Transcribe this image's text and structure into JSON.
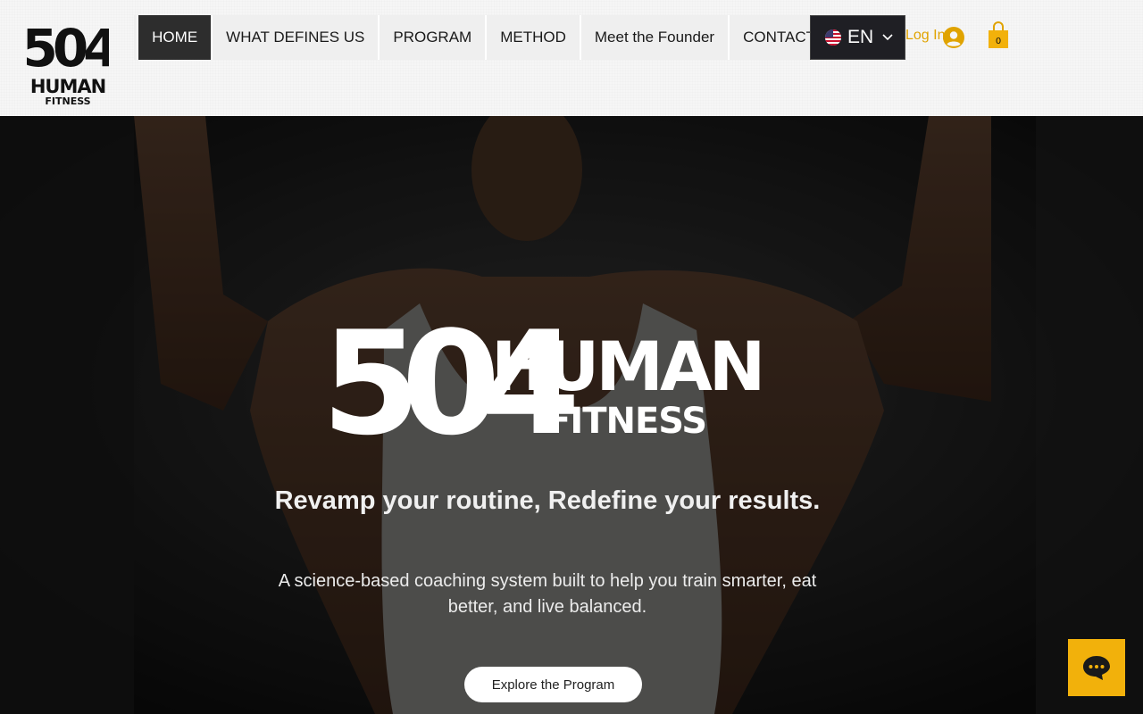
{
  "brand": {
    "name": "504 HUMAN FITNESS",
    "logo_numbers": "504",
    "logo_word": "HUMAN",
    "logo_sub": "FITNESS"
  },
  "nav": {
    "items": [
      {
        "label": "HOME",
        "active": true
      },
      {
        "label": "WHAT DEFINES US"
      },
      {
        "label": "PROGRAM"
      },
      {
        "label": "METHOD"
      },
      {
        "label": "Meet the Founder"
      },
      {
        "label": "CONTACT"
      }
    ]
  },
  "language": {
    "code": "EN",
    "flag": "us-flag-icon"
  },
  "account": {
    "login_label": "Log In",
    "cart_count": "0"
  },
  "hero": {
    "tagline": "Revamp your routine, Redefine your results.",
    "subtext": "A science-based coaching system built to help you train smarter, eat better, and live balanced.",
    "cta_label": "Explore the Program"
  },
  "colors": {
    "accent": "#f2b10b",
    "login_text": "#e0a300",
    "nav_active_bg": "#2d2d2d",
    "header_bg": "#f6f6f6"
  },
  "icons": {
    "chat": "chat-bubble-icon",
    "cart": "shopping-bag-icon",
    "avatar": "user-avatar-icon",
    "chevron": "chevron-down-icon"
  }
}
